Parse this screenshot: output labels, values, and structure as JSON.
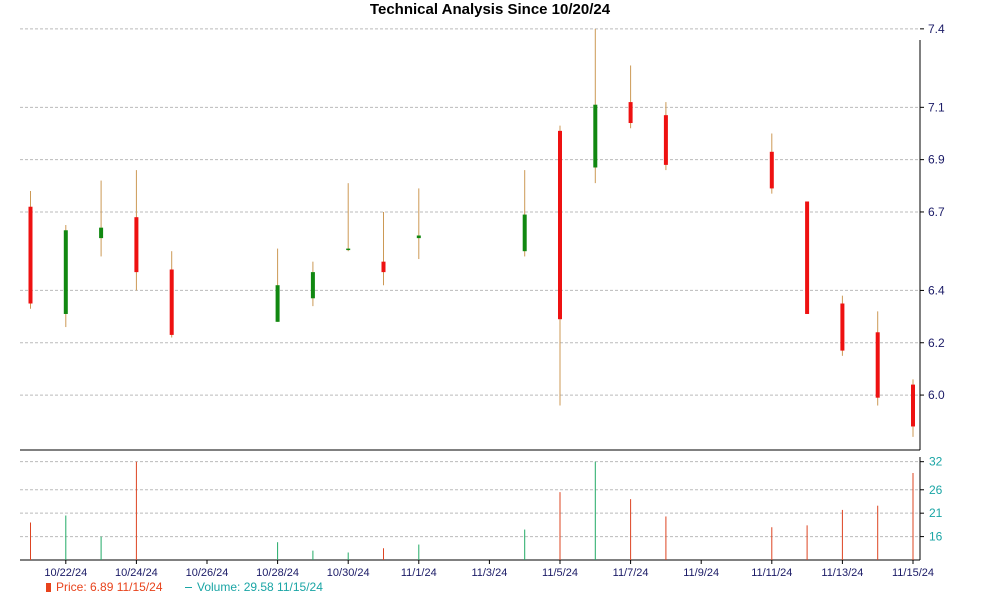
{
  "chart_data": {
    "type": "candlestick",
    "title": "Technical Analysis Since 10/20/24",
    "price_axis": {
      "ticks": [
        6.0,
        6.2,
        6.4,
        6.7,
        6.9,
        7.1,
        7.4
      ],
      "ylim": [
        5.79,
        7.43
      ],
      "side": "right"
    },
    "volume_axis": {
      "ticks": [
        16,
        21,
        26,
        32
      ],
      "ylim": [
        11,
        33
      ],
      "side": "right"
    },
    "x_tick_labels": [
      "10/22/24",
      "10/24/24",
      "10/26/24",
      "10/28/24",
      "10/30/24",
      "11/1/24",
      "11/3/24",
      "11/5/24",
      "11/7/24",
      "11/9/24",
      "11/11/24",
      "11/13/24",
      "11/15/24"
    ],
    "grid": true,
    "candles": [
      {
        "date": "10/21/24",
        "open": 6.72,
        "high": 6.78,
        "low": 6.33,
        "close": 6.35,
        "volume": 19
      },
      {
        "date": "10/22/24",
        "open": 6.31,
        "high": 6.65,
        "low": 6.26,
        "close": 6.63,
        "volume": 20.5
      },
      {
        "date": "10/23/24",
        "open": 6.6,
        "high": 6.82,
        "low": 6.53,
        "close": 6.64,
        "volume": 16
      },
      {
        "date": "10/24/24",
        "open": 6.68,
        "high": 6.86,
        "low": 6.4,
        "close": 6.47,
        "volume": 32
      },
      {
        "date": "10/25/24",
        "open": 6.48,
        "high": 6.55,
        "low": 6.22,
        "close": 6.23,
        "volume": null
      },
      {
        "date": "10/28/24",
        "open": 6.28,
        "high": 6.56,
        "low": 6.28,
        "close": 6.42,
        "volume": 14.8
      },
      {
        "date": "10/29/24",
        "open": 6.37,
        "high": 6.51,
        "low": 6.34,
        "close": 6.47,
        "volume": 13
      },
      {
        "date": "10/30/24",
        "open": 6.56,
        "high": 6.81,
        "low": 6.55,
        "close": 6.56,
        "volume": 12.6
      },
      {
        "date": "10/31/24",
        "open": 6.51,
        "high": 6.7,
        "low": 6.42,
        "close": 6.47,
        "volume": 13.5
      },
      {
        "date": "11/1/24",
        "open": 6.6,
        "high": 6.79,
        "low": 6.52,
        "close": 6.61,
        "volume": 14.3
      },
      {
        "date": "11/4/24",
        "open": 6.55,
        "high": 6.86,
        "low": 6.53,
        "close": 6.69,
        "volume": 17.5
      },
      {
        "date": "11/5/24",
        "open": 7.01,
        "high": 7.03,
        "low": 5.96,
        "close": 6.29,
        "volume": 25.5
      },
      {
        "date": "11/6/24",
        "open": 6.87,
        "high": 7.4,
        "low": 6.81,
        "close": 7.11,
        "volume": 32
      },
      {
        "date": "11/7/24",
        "open": 7.12,
        "high": 7.26,
        "low": 7.02,
        "close": 7.04,
        "volume": 24
      },
      {
        "date": "11/8/24",
        "open": 7.07,
        "high": 7.12,
        "low": 6.86,
        "close": 6.88,
        "volume": 20.3
      },
      {
        "date": "11/11/24",
        "open": 6.93,
        "high": 7.0,
        "low": 6.77,
        "close": 6.79,
        "volume": 18
      },
      {
        "date": "11/12/24",
        "open": 6.74,
        "high": 6.74,
        "low": 6.31,
        "close": 6.31,
        "volume": 18.4
      },
      {
        "date": "11/13/24",
        "open": 6.35,
        "high": 6.38,
        "low": 6.15,
        "close": 6.17,
        "volume": 21.7
      },
      {
        "date": "11/14/24",
        "open": 6.24,
        "high": 6.32,
        "low": 5.96,
        "close": 5.99,
        "volume": 22.6
      },
      {
        "date": "11/15/24",
        "open": 6.04,
        "high": 6.06,
        "low": 5.84,
        "close": 5.88,
        "volume": 29.58
      }
    ],
    "legend": {
      "price": "Price: 6.89  11/15/24",
      "volume": "Volume: 29.58  11/15/24",
      "placement": "bottom-left"
    },
    "colors": {
      "up": "#118811",
      "down": "#ee1111",
      "wick": "#cc9955",
      "grid": "#bbbbbb",
      "price_tick": "#1a1a66",
      "volume_tick": "#1aa5a5",
      "volume_up": "#22aa66",
      "volume_down": "#dd4422"
    }
  }
}
